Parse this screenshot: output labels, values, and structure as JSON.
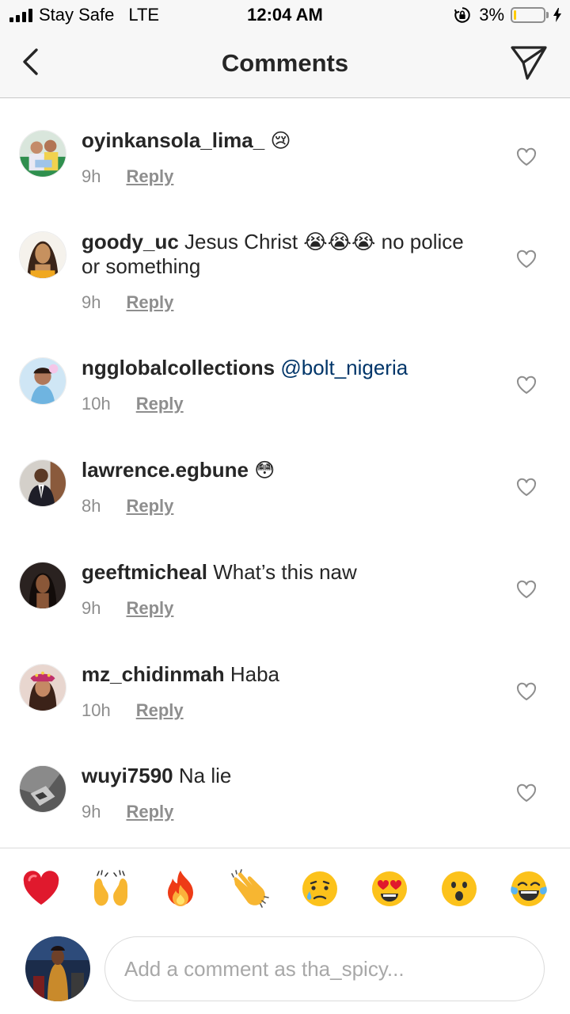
{
  "status_bar": {
    "carrier": "Stay Safe",
    "network": "LTE",
    "time": "12:04 AM",
    "battery_text": "3%",
    "battery_level": 0.03
  },
  "header": {
    "title": "Comments",
    "back_icon": "chevron-left-icon",
    "share_icon": "paper-plane-icon"
  },
  "comments": [
    {
      "username": "oyinkansola_lima_",
      "text": "😢",
      "time": "9h",
      "reply_label": "Reply"
    },
    {
      "username": "goody_uc",
      "text": "Jesus Christ 😭😭😭 no police or something",
      "time": "9h",
      "reply_label": "Reply"
    },
    {
      "username": "ngglobalcollections",
      "mention": "@bolt_nigeria",
      "time": "10h",
      "reply_label": "Reply"
    },
    {
      "username": "lawrence.egbune",
      "text": "😳",
      "time": "8h",
      "reply_label": "Reply"
    },
    {
      "username": "geeftmicheal",
      "text": "What’s this naw",
      "time": "9h",
      "reply_label": "Reply"
    },
    {
      "username": "mz_chidinmah",
      "text": "Haba",
      "time": "10h",
      "reply_label": "Reply"
    },
    {
      "username": "wuyi7590",
      "text": "Na lie",
      "time": "9h",
      "reply_label": "Reply"
    }
  ],
  "emoji_bar": [
    "red-heart",
    "raising-hands",
    "fire",
    "clapping-hands",
    "crying-face",
    "heart-eyes",
    "surprised-face",
    "tears-of-joy"
  ],
  "composer": {
    "placeholder": "Add a comment as tha_spicy..."
  },
  "colors": {
    "mention": "#003569",
    "secondary_text": "#8e8e8e",
    "battery": "#ffcc00"
  }
}
